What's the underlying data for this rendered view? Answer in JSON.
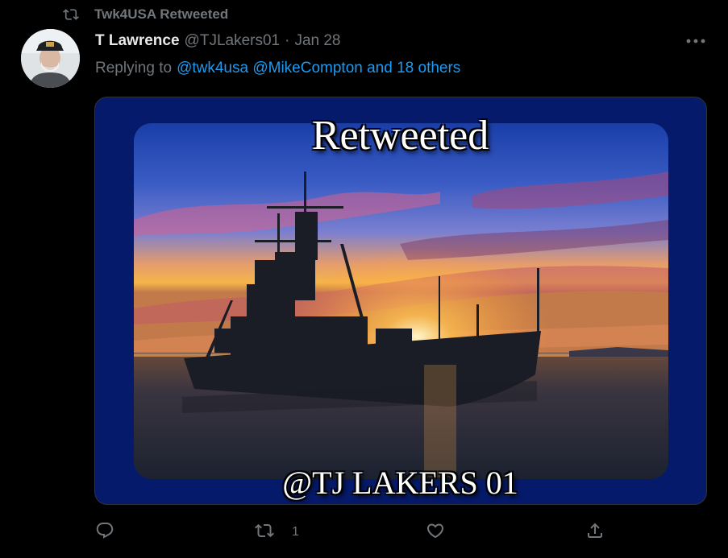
{
  "retweet": {
    "icon": "retweet-icon",
    "label": "Twk4USA Retweeted"
  },
  "author": {
    "avatar": "avatar",
    "display_name": "T Lawrence",
    "handle": "@TJLakers01",
    "separator": "·",
    "date": "Jan 28"
  },
  "more": {
    "icon": "more-horizontal-icon"
  },
  "reply": {
    "prefix": "Replying to",
    "mentions": "@twk4usa @MikeCompton and 18 others"
  },
  "media": {
    "title": "Retweeted",
    "caption": "@TJ LAKERS 01",
    "frame_color": "#061a6b"
  },
  "actions": {
    "reply": {
      "icon": "reply-icon"
    },
    "retweet": {
      "icon": "retweet-icon",
      "count": "1"
    },
    "like": {
      "icon": "heart-icon"
    },
    "share": {
      "icon": "share-icon"
    }
  },
  "colors": {
    "background": "#000000",
    "text": "#e7e9ea",
    "muted": "#71767b",
    "link": "#1d9bf0"
  }
}
